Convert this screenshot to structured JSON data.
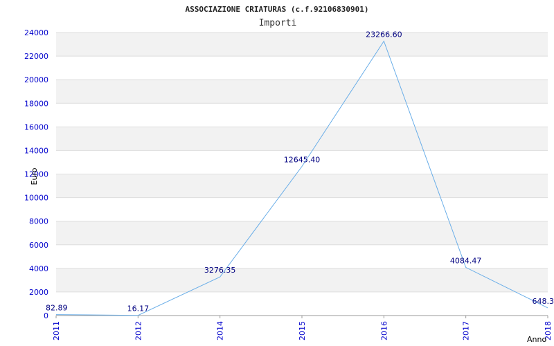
{
  "chart_data": {
    "type": "line",
    "title": "ASSOCIAZIONE CRIATURAS (c.f.92106830901)",
    "subtitle": "Importi",
    "xlabel": "Anno",
    "ylabel": "Euro",
    "categories": [
      "2011",
      "2012",
      "2014",
      "2015",
      "2016",
      "2017",
      "2018"
    ],
    "series": [
      {
        "values": [
          82.89,
          16.17,
          3276.35,
          12645.4,
          23266.6,
          4084.47,
          648.3
        ]
      }
    ],
    "data_labels": [
      "82.89",
      "16.17",
      "3276.35",
      "12645.40",
      "23266.60",
      "4084.47",
      "648.3"
    ],
    "ylim": [
      0,
      24000
    ],
    "yticks": [
      "0",
      "2000",
      "4000",
      "6000",
      "8000",
      "10000",
      "12000",
      "14000",
      "16000",
      "18000",
      "20000",
      "22000",
      "24000"
    ],
    "grid": true,
    "colors": {
      "line": "#6aaee8",
      "band": "#f2f2f2",
      "tick_text": "#0000cc",
      "label_text": "#000080"
    }
  }
}
